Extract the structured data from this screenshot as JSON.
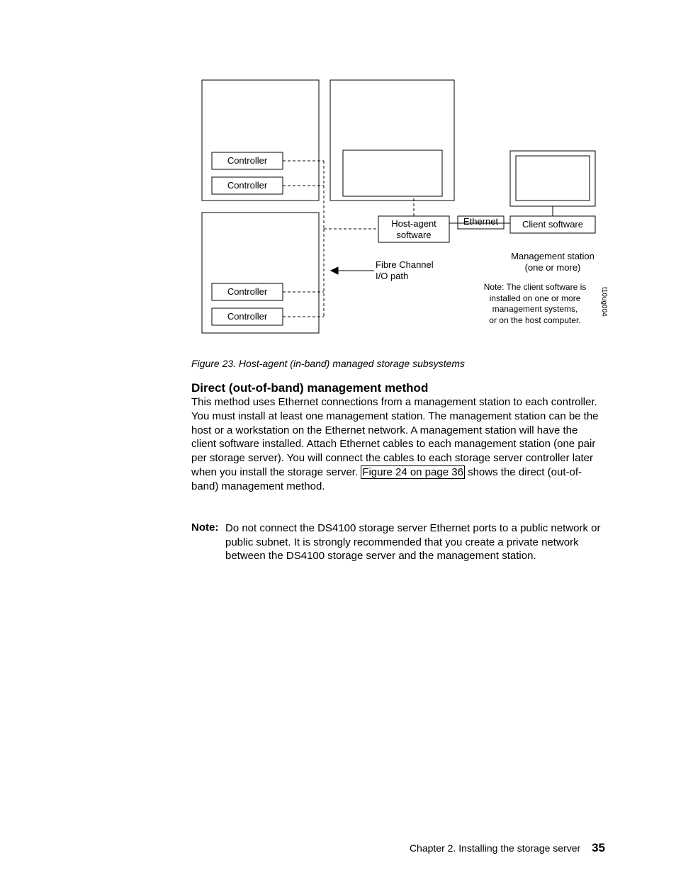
{
  "diagram": {
    "controller_tl1": "Controller",
    "controller_tl2": "Controller",
    "controller_bl1": "Controller",
    "controller_bl2": "Controller",
    "host_agent_label": "Host-agent<br>software",
    "ethernet_label": "Ethernet",
    "client_label": "Client software",
    "mgmt_station_label": "Management station<br>(one or more)",
    "fibre_label": "Fibre Channel<br>I/O path",
    "client_note": "Note: The client software is<br>installed on one or more<br>management systems,<br>or on the host computer.",
    "diagram_id": "t10ug004"
  },
  "caption": "Figure 23. Host-agent (in-band) managed storage subsystems",
  "heading": "Direct (out-of-band) management method",
  "para1_a": "This method uses Ethernet connections from a management station to each controller. You must install at least one management station. The management station can be the host or a workstation on the Ethernet network. A management station will have the client software installed. Attach Ethernet cables to each management station (one pair per storage server). You will connect the cables to each storage server controller later when you install the storage server. ",
  "xref": "Figure 24 on page 36",
  "para1_b": " shows the direct (out-of-band) management method.",
  "note_label": "Note:",
  "note_body": "Do not connect the DS4100 storage server Ethernet ports to a public network or public subnet. It is strongly recommended that you create a private network between the DS4100 storage server and the management station.",
  "footer_text": "Chapter 2. Installing the storage server",
  "page_number": "35"
}
